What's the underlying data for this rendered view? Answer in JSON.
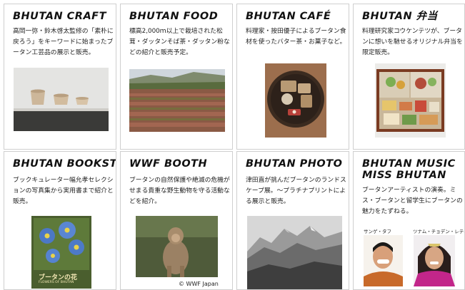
{
  "cards": [
    {
      "title": "BHUTAN CRAFT",
      "desc": "高岡一弥・鈴木啓太監修の「素朴に戻ろう」をキーワードに始まったブータン工芸品の展示と販売。"
    },
    {
      "title": "BHUTAN FOOD",
      "desc": "標高2,000ｍ以上で栽培された松茸・ダッタンそば茶・ダッタン粉などの紹介と販売予定。"
    },
    {
      "title": "BHUTAN CAFÉ",
      "desc": "料理家・按田優子によるブータン食材を使ったバター茶・お菓子など。"
    },
    {
      "title": "BHUTAN 弁当",
      "desc": "料理研究家コウケンテツが、ブータンに想いを馳せるオリジナル弁当を限定販売。"
    },
    {
      "title": "BHUTAN BOOKSTORE",
      "desc": "ブックキュレーター幅允孝セレクションの写真集から実用書まで紹介と販売。"
    },
    {
      "title": "WWF BOOTH",
      "desc": "ブータンの自然保護や絶滅の危機がせまる貴重な野生動物を守る活動などを紹介。"
    },
    {
      "title": "BHUTAN PHOTO",
      "desc": "津田直が挑んだブータンのランドスケープ展。〜プラチナプリントによる展示と販売。"
    },
    {
      "title": "BHUTAN MUSIC MISS BHUTAN",
      "desc": "ブータンアーティストの演奏。ミス・ブータンと留学生にブータンの魅力をたずねる。"
    }
  ],
  "book_cover_text": "ブータンの花",
  "book_cover_sub": "FLOWERS OF BHUTAN",
  "wwf_credit": "© WWF Japan",
  "person_left": "サンゲ・タフ",
  "person_right": "ツナム・チョデン・レティ"
}
